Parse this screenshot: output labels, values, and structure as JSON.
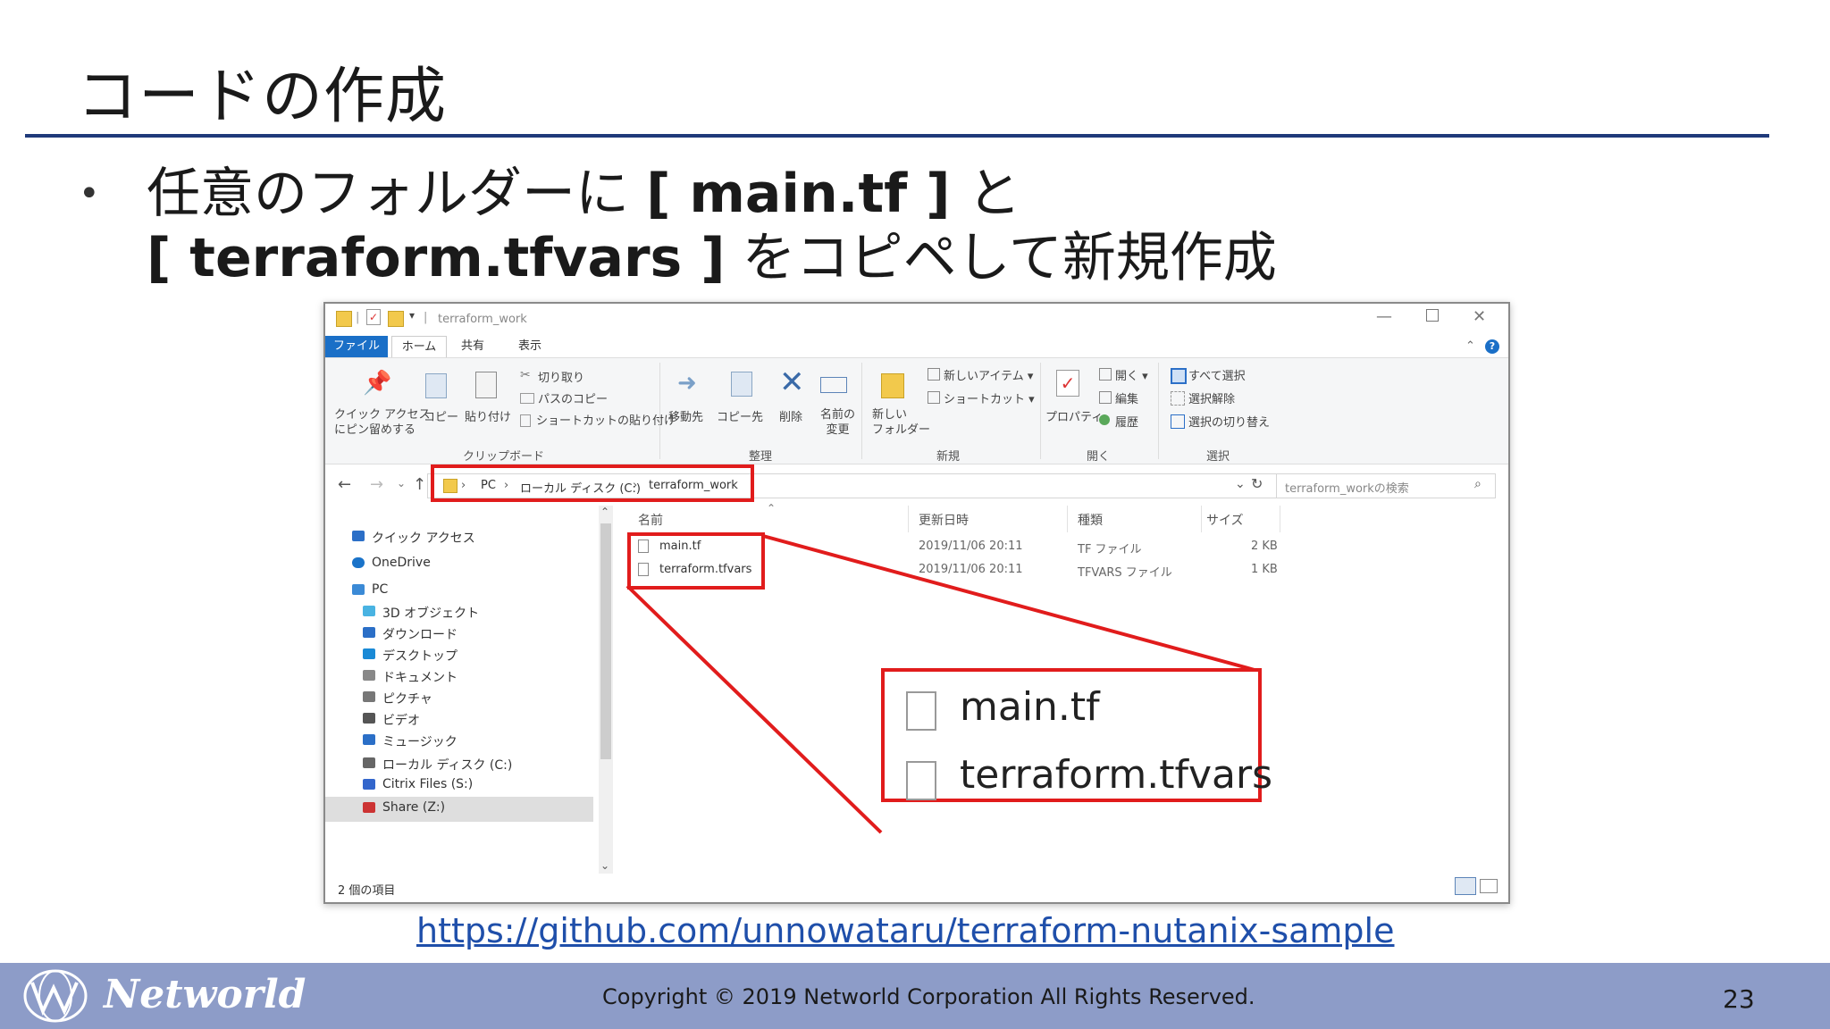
{
  "slide": {
    "title": "コードの作成",
    "bullet_line1_prefix": "任意のフォルダーに",
    "bullet_line1_bold": "[ main.tf ]",
    "bullet_line1_suffix": "と",
    "bullet_line2_bold": "[ terraform.tfvars ]",
    "bullet_line2_suffix": "をコピペして新規作成",
    "link": "https://github.com/unnowataru/terraform-nutanix-sample",
    "brand": "Networld",
    "copyright": "Copyright © 2019 Networld Corporation All Rights Reserved.",
    "page_number": "23"
  },
  "explorer": {
    "window_title": "terraform_work",
    "menu": {
      "file": "ファイル",
      "home": "ホーム",
      "share": "共有",
      "view": "表示"
    },
    "ribbon": {
      "pin_quick_access": [
        "クイック アクセス",
        "にピン留めする"
      ],
      "copy": "コピー",
      "paste": "貼り付け",
      "cut": "切り取り",
      "copy_path": "パスのコピー",
      "paste_shortcut": "ショートカットの貼り付け",
      "clipboard": "クリップボード",
      "move_to": "移動先",
      "copy_to": "コピー先",
      "delete": "削除",
      "rename": [
        "名前の",
        "変更"
      ],
      "organize": "整理",
      "new_folder": [
        "新しい",
        "フォルダー"
      ],
      "new_item": "新しいアイテム",
      "shortcut": "ショートカット",
      "new": "新規",
      "properties": "プロパティ",
      "open_small": "開く",
      "edit": "編集",
      "history": "履歴",
      "open": "開く",
      "select_all": "すべて選択",
      "select_none": "選択解除",
      "invert_selection": "選択の切り替え",
      "select": "選択"
    },
    "address": {
      "pc": "PC",
      "drive": "ローカル ディスク (C:)",
      "folder": "terraform_work"
    },
    "search_placeholder": "terraform_workの検索",
    "nav": [
      {
        "label": "クイック アクセス",
        "icon": "star-icon",
        "color": "#2b6fc7"
      },
      {
        "label": "OneDrive",
        "icon": "cloud-icon",
        "color": "#1a73c9"
      },
      {
        "label": "PC",
        "icon": "computer-icon",
        "color": "#3b8ad6"
      },
      {
        "label": "3D オブジェクト",
        "icon": "cube-icon",
        "color": "#49b3e2"
      },
      {
        "label": "ダウンロード",
        "icon": "download-arrow-icon",
        "color": "#2b6fc7"
      },
      {
        "label": "デスクトップ",
        "icon": "desktop-icon",
        "color": "#1a8ad6"
      },
      {
        "label": "ドキュメント",
        "icon": "document-icon",
        "color": "#888888"
      },
      {
        "label": "ピクチャ",
        "icon": "picture-icon",
        "color": "#777777"
      },
      {
        "label": "ビデオ",
        "icon": "video-icon",
        "color": "#555555"
      },
      {
        "label": "ミュージック",
        "icon": "music-note-icon",
        "color": "#2b6fc7"
      },
      {
        "label": "ローカル ディスク (C:)",
        "icon": "drive-icon",
        "color": "#666666"
      },
      {
        "label": "Citrix Files (S:)",
        "icon": "citrix-icon",
        "color": "#3366cc"
      },
      {
        "label": "Share (Z:)",
        "icon": "network-drive-icon",
        "color": "#cc3333"
      }
    ],
    "columns": {
      "name": "名前",
      "date": "更新日時",
      "type": "種類",
      "size": "サイズ"
    },
    "files": [
      {
        "name": "main.tf",
        "date": "2019/11/06 20:11",
        "type": "TF ファイル",
        "size": "2 KB"
      },
      {
        "name": "terraform.tfvars",
        "date": "2019/11/06 20:11",
        "type": "TFVARS ファイル",
        "size": "1 KB"
      }
    ],
    "status": "2 個の項目",
    "zoom_files": [
      "main.tf",
      "terraform.tfvars"
    ]
  },
  "colors": {
    "accent_blue": "#1a6fc7",
    "highlight_red": "#e11c1c",
    "title_rule": "#1f3a7a",
    "footer": "#8d9cc8"
  }
}
